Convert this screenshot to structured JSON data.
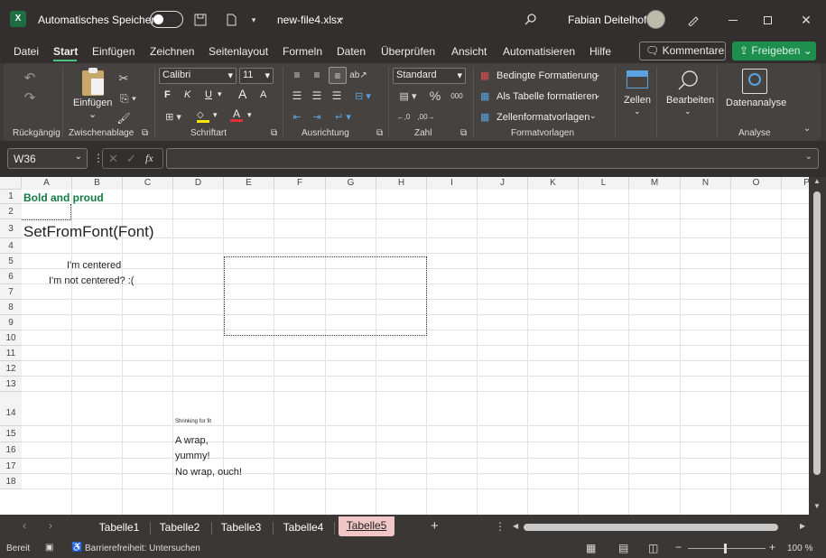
{
  "title": {
    "autosave_label": "Automatisches Speichern",
    "filename": "new-file4.xlsx",
    "user": "Fabian Deitelhoff"
  },
  "menu": [
    "Datei",
    "Start",
    "Einfügen",
    "Zeichnen",
    "Seitenlayout",
    "Formeln",
    "Daten",
    "Überprüfen",
    "Ansicht",
    "Automatisieren",
    "Hilfe"
  ],
  "menu_active": "Start",
  "comments_button": "Kommentare",
  "share_button": "Freigeben",
  "ribbon": {
    "undo_group": "Rückgängig",
    "clipboard": {
      "paste": "Einfügen",
      "group": "Zwischenablage"
    },
    "font": {
      "name": "Calibri",
      "size": "11",
      "group": "Schriftart"
    },
    "alignment": {
      "group": "Ausrichtung"
    },
    "number": {
      "format": "Standard",
      "group": "Zahl"
    },
    "styles": {
      "conditional": "Bedingte Formatierung",
      "as_table": "Als Tabelle formatieren",
      "cell_styles": "Zellenformatvorlagen",
      "group": "Formatvorlagen"
    },
    "cells": "Zellen",
    "editing": "Bearbeiten",
    "analysis": {
      "button": "Datenanalyse",
      "group": "Analyse"
    }
  },
  "namebox": "W36",
  "fx": "fx",
  "columns": [
    "A",
    "B",
    "C",
    "D",
    "E",
    "F",
    "G",
    "H",
    "I",
    "J",
    "K",
    "L",
    "M",
    "N",
    "O",
    "P"
  ],
  "rows": [
    "1",
    "2",
    "3",
    "4",
    "5",
    "6",
    "7",
    "8",
    "9",
    "10",
    "11",
    "12",
    "13",
    "14",
    "15",
    "16",
    "17",
    "18"
  ],
  "cells": {
    "a1": "Bold and proud",
    "a3": "SetFromFont(Font)",
    "b5": "I'm centered",
    "b6": "I'm not centered? :(",
    "d14": "Shrinking for fit",
    "d15a": "A wrap,",
    "d15b": "yummy!",
    "d16": "No wrap, ouch!"
  },
  "colors": {
    "bold_green": "#107c41",
    "share_green": "#1e8e4e"
  },
  "sheets": [
    "Tabelle1",
    "Tabelle2",
    "Tabelle3",
    "Tabelle4",
    "Tabelle5"
  ],
  "active_sheet": "Tabelle5",
  "status": {
    "ready": "Bereit",
    "accessibility": "Barrierefreiheit: Untersuchen",
    "zoom": "100 %"
  }
}
